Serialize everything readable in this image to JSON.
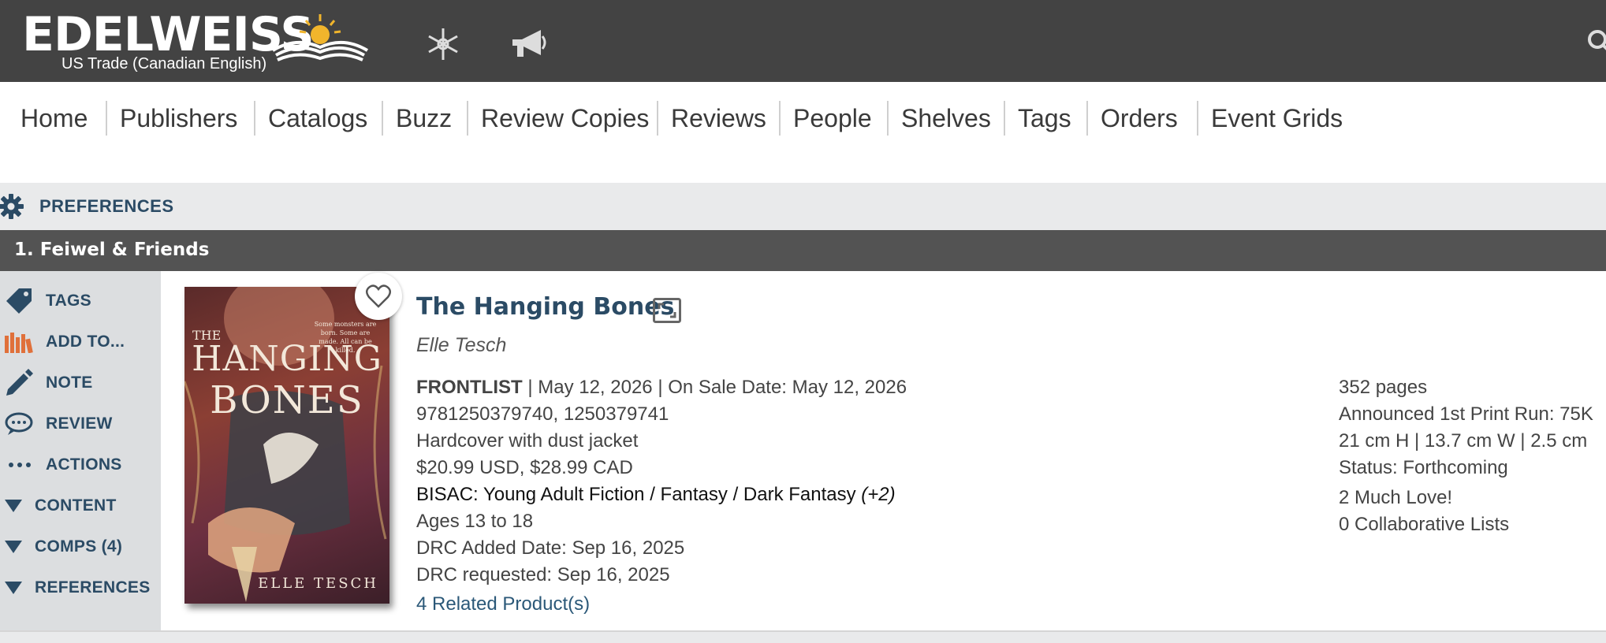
{
  "header": {
    "logo_text": "EDELWEISS",
    "logo_subtitle": "US Trade (Canadian English)"
  },
  "nav": [
    "Home",
    "Publishers",
    "Catalogs",
    "Buzz",
    "Review Copies",
    "Reviews",
    "People",
    "Shelves",
    "Tags",
    "Orders",
    "Event Grids"
  ],
  "preferences_label": "PREFERENCES",
  "section_title": "1. Feiwel & Friends",
  "sidebar": {
    "items": [
      {
        "label": "TAGS",
        "icon": "tag-icon"
      },
      {
        "label": "ADD TO...",
        "icon": "books-icon"
      },
      {
        "label": "NOTE",
        "icon": "pencil-icon"
      },
      {
        "label": "REVIEW",
        "icon": "speech-bubble-icon"
      },
      {
        "label": "ACTIONS",
        "icon": "ellipsis-icon"
      },
      {
        "label": "CONTENT",
        "icon": "triangle-down-icon"
      },
      {
        "label": "COMPS (4)",
        "icon": "triangle-down-icon"
      },
      {
        "label": "REFERENCES",
        "icon": "triangle-down-icon"
      }
    ]
  },
  "book": {
    "cover": {
      "title_line1": "THE",
      "title_line2": "HANGING",
      "title_line3": "BONES",
      "author": "ELLE TESCH",
      "tagline": "Some monsters are born. Some are made. All can be killed."
    },
    "title": "The Hanging Bones",
    "author": "Elle Tesch",
    "list": "FRONTLIST",
    "pub_date": " | May 12, 2026 | On Sale Date: May 12, 2026",
    "isbns": "9781250379740, 1250379741",
    "format": "Hardcover with dust jacket",
    "price": "$20.99 USD, $28.99 CAD",
    "bisac": "BISAC: Young Adult Fiction / Fantasy / Dark Fantasy ",
    "bisac_more": "(+2)",
    "ages": "Ages 13 to 18",
    "drc_added": "DRC Added Date: Sep 16, 2025",
    "drc_requested": "DRC requested: Sep 16, 2025",
    "related": "4 Related Product(s)",
    "pages": "352 pages",
    "print_run": "Announced 1st Print Run: 75K",
    "dimensions": "21 cm H | 13.7 cm W | 2.5 cm",
    "status": "Status: Forthcoming",
    "much_love": "2 Much Love!",
    "collab_lists": "0 Collaborative Lists"
  },
  "colors": {
    "header_bg": "#434343",
    "link_blue": "#2b4b65",
    "accent_orange": "#e0703a"
  }
}
